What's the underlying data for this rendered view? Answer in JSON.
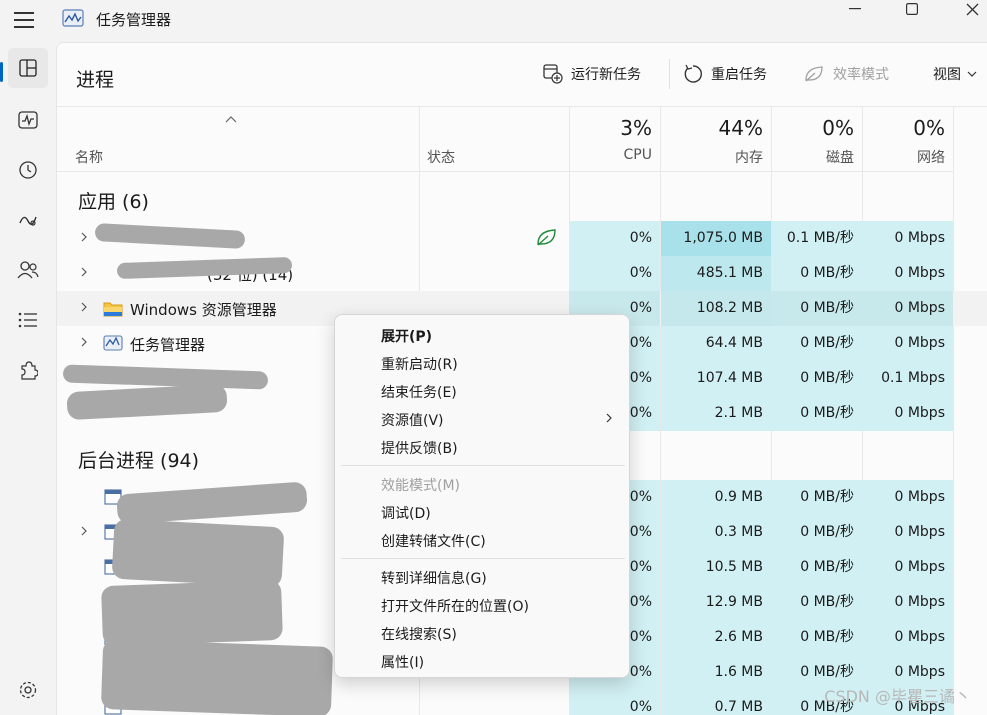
{
  "app": {
    "title": "任务管理器"
  },
  "header": {
    "title": "进程",
    "commands": {
      "run_new_task": "运行新任务",
      "restart_task": "重启任务",
      "efficiency_mode": "效率模式",
      "view": "视图"
    }
  },
  "columns": {
    "name": "名称",
    "status": "状态",
    "cpu": {
      "percent": "3%",
      "label": "CPU"
    },
    "memory": {
      "percent": "44%",
      "label": "内存"
    },
    "disk": {
      "percent": "0%",
      "label": "磁盘"
    },
    "network": {
      "percent": "0%",
      "label": "网络"
    }
  },
  "apps_section": {
    "title": "应用 (6)"
  },
  "app_rows": [
    {
      "name": "",
      "cpu": "0%",
      "memory": "1,075.0 MB",
      "disk": "0.1 MB/秒",
      "network": "0 Mbps"
    },
    {
      "name": "(32 位) (14)",
      "cpu": "0%",
      "memory": "485.1 MB",
      "disk": "0 MB/秒",
      "network": "0 Mbps"
    },
    {
      "name": "Windows 资源管理器",
      "cpu": "0%",
      "memory": "108.2 MB",
      "disk": "0 MB/秒",
      "network": "0 Mbps"
    },
    {
      "name": "任务管理器",
      "cpu": "0%",
      "memory": "64.4 MB",
      "disk": "0 MB/秒",
      "network": "0 Mbps"
    },
    {
      "name": "",
      "cpu": "0%",
      "memory": "107.4 MB",
      "disk": "0 MB/秒",
      "network": "0.1 Mbps"
    },
    {
      "name": "",
      "cpu": "0%",
      "memory": "2.1 MB",
      "disk": "0 MB/秒",
      "network": "0 Mbps"
    }
  ],
  "bg_section": {
    "title": "后台进程 (94)"
  },
  "bg_rows": [
    {
      "cpu": "0%",
      "memory": "0.9 MB",
      "disk": "0 MB/秒",
      "network": "0 Mbps"
    },
    {
      "cpu": "0%",
      "memory": "0.3 MB",
      "disk": "0 MB/秒",
      "network": "0 Mbps"
    },
    {
      "cpu": "0%",
      "memory": "10.5 MB",
      "disk": "0 MB/秒",
      "network": "0 Mbps"
    },
    {
      "cpu": "0%",
      "memory": "12.9 MB",
      "disk": "0 MB/秒",
      "network": "0 Mbps"
    },
    {
      "cpu": "0%",
      "memory": "2.6 MB",
      "disk": "0 MB/秒",
      "network": "0 Mbps"
    },
    {
      "cpu": "0%",
      "memory": "1.6 MB",
      "disk": "0 MB/秒",
      "network": "0 Mbps"
    },
    {
      "cpu": "0%",
      "memory": "0.7 MB",
      "disk": "0 MB/秒",
      "network": "0 Mbps"
    }
  ],
  "context_menu": {
    "expand": "展开(P)",
    "restart": "重新启动(R)",
    "end_task": "结束任务(E)",
    "resource_values": "资源值(V)",
    "feedback": "提供反馈(B)",
    "efficiency_mode": "效能模式(M)",
    "debug": "调试(D)",
    "create_dump": "创建转储文件(C)",
    "go_to_details": "转到详细信息(G)",
    "open_file_location": "打开文件所在的位置(O)",
    "search_online": "在线搜索(S)",
    "properties": "属性(I)"
  },
  "watermark": "CSDN @毕瞿三谲丶"
}
